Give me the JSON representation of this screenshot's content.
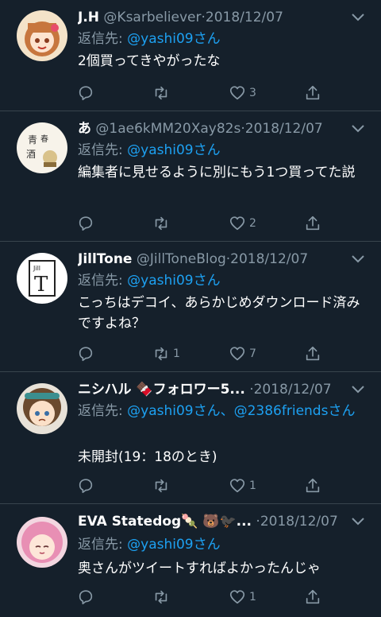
{
  "colors": {
    "background": "#15202b",
    "text": "#ffffff",
    "secondary": "#8899a6",
    "link": "#1da1f2",
    "divider": "#38444d"
  },
  "tweets": [
    {
      "name": "J.H",
      "handle": "@Ksarbeliever",
      "sep": "·",
      "date": "2018/12/07",
      "reply_prefix": "返信先: ",
      "reply_to": "@yashi09さん",
      "reply_rest": "",
      "text": "2個買ってきやがったな",
      "reply_count": "",
      "retweet_count": "",
      "like_count": "3",
      "avatar_icon": "anime-girl-avatar"
    },
    {
      "name": "あ",
      "handle": "@1ae6kMM20Xay82s",
      "sep": "·",
      "date": "2018/12/07",
      "reply_prefix": "返信先: ",
      "reply_to": "@yashi09さん",
      "reply_rest": "",
      "text": "編集者に見せるように別にもう1つ買ってた説",
      "reply_count": "",
      "retweet_count": "",
      "like_count": "2",
      "avatar_icon": "calligraphy-avatar"
    },
    {
      "name": "JillTone",
      "handle": "@JillToneBlog",
      "sep": "·",
      "date": "2018/12/07",
      "reply_prefix": "返信先: ",
      "reply_to": "@yashi09さん",
      "reply_rest": "",
      "text": "こっちはデコイ、あらかじめダウンロード済みですよね？",
      "reply_count": "",
      "retweet_count": "1",
      "like_count": "7",
      "avatar_icon": "jilltone-logo-avatar"
    },
    {
      "name": "ニシハル 🍫フォロワー5...",
      "handle": "",
      "sep": "·",
      "date": "2018/12/07",
      "reply_prefix": "返信先: ",
      "reply_to": "@yashi09さん、@2386friendsさん",
      "reply_rest": "",
      "text": "未開封(19：18のとき)",
      "reply_count": "",
      "retweet_count": "",
      "like_count": "1",
      "avatar_icon": "anime-character-avatar"
    },
    {
      "name": "EVA Statedog🍡 🐻🐦‍⬛...",
      "handle": "",
      "sep": "·",
      "date": "2018/12/07",
      "reply_prefix": "返信先: ",
      "reply_to": "@yashi09さん",
      "reply_rest": "",
      "text": "奥さんがツイートすればよかったんじゃ",
      "reply_count": "",
      "retweet_count": "",
      "like_count": "1",
      "avatar_icon": "pink-hair-avatar"
    }
  ]
}
